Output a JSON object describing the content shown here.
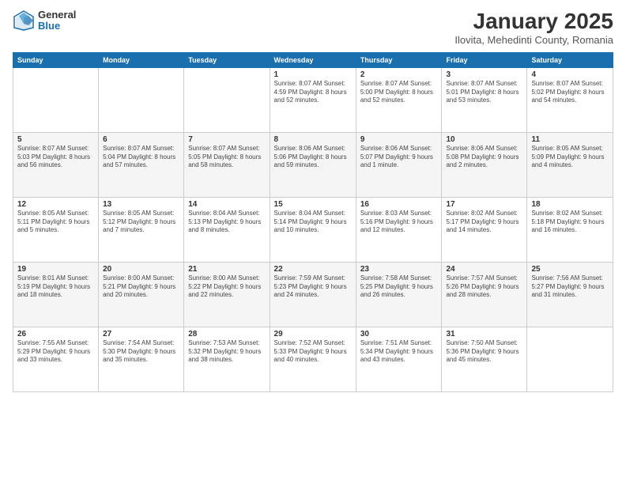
{
  "logo": {
    "general": "General",
    "blue": "Blue"
  },
  "title": "January 2025",
  "location": "Ilovita, Mehedinti County, Romania",
  "weekdays": [
    "Sunday",
    "Monday",
    "Tuesday",
    "Wednesday",
    "Thursday",
    "Friday",
    "Saturday"
  ],
  "weeks": [
    [
      {
        "day": "",
        "info": ""
      },
      {
        "day": "",
        "info": ""
      },
      {
        "day": "",
        "info": ""
      },
      {
        "day": "1",
        "info": "Sunrise: 8:07 AM\nSunset: 4:59 PM\nDaylight: 8 hours\nand 52 minutes."
      },
      {
        "day": "2",
        "info": "Sunrise: 8:07 AM\nSunset: 5:00 PM\nDaylight: 8 hours\nand 52 minutes."
      },
      {
        "day": "3",
        "info": "Sunrise: 8:07 AM\nSunset: 5:01 PM\nDaylight: 8 hours\nand 53 minutes."
      },
      {
        "day": "4",
        "info": "Sunrise: 8:07 AM\nSunset: 5:02 PM\nDaylight: 8 hours\nand 54 minutes."
      }
    ],
    [
      {
        "day": "5",
        "info": "Sunrise: 8:07 AM\nSunset: 5:03 PM\nDaylight: 8 hours\nand 56 minutes."
      },
      {
        "day": "6",
        "info": "Sunrise: 8:07 AM\nSunset: 5:04 PM\nDaylight: 8 hours\nand 57 minutes."
      },
      {
        "day": "7",
        "info": "Sunrise: 8:07 AM\nSunset: 5:05 PM\nDaylight: 8 hours\nand 58 minutes."
      },
      {
        "day": "8",
        "info": "Sunrise: 8:06 AM\nSunset: 5:06 PM\nDaylight: 8 hours\nand 59 minutes."
      },
      {
        "day": "9",
        "info": "Sunrise: 8:06 AM\nSunset: 5:07 PM\nDaylight: 9 hours\nand 1 minute."
      },
      {
        "day": "10",
        "info": "Sunrise: 8:06 AM\nSunset: 5:08 PM\nDaylight: 9 hours\nand 2 minutes."
      },
      {
        "day": "11",
        "info": "Sunrise: 8:05 AM\nSunset: 5:09 PM\nDaylight: 9 hours\nand 4 minutes."
      }
    ],
    [
      {
        "day": "12",
        "info": "Sunrise: 8:05 AM\nSunset: 5:11 PM\nDaylight: 9 hours\nand 5 minutes."
      },
      {
        "day": "13",
        "info": "Sunrise: 8:05 AM\nSunset: 5:12 PM\nDaylight: 9 hours\nand 7 minutes."
      },
      {
        "day": "14",
        "info": "Sunrise: 8:04 AM\nSunset: 5:13 PM\nDaylight: 9 hours\nand 8 minutes."
      },
      {
        "day": "15",
        "info": "Sunrise: 8:04 AM\nSunset: 5:14 PM\nDaylight: 9 hours\nand 10 minutes."
      },
      {
        "day": "16",
        "info": "Sunrise: 8:03 AM\nSunset: 5:16 PM\nDaylight: 9 hours\nand 12 minutes."
      },
      {
        "day": "17",
        "info": "Sunrise: 8:02 AM\nSunset: 5:17 PM\nDaylight: 9 hours\nand 14 minutes."
      },
      {
        "day": "18",
        "info": "Sunrise: 8:02 AM\nSunset: 5:18 PM\nDaylight: 9 hours\nand 16 minutes."
      }
    ],
    [
      {
        "day": "19",
        "info": "Sunrise: 8:01 AM\nSunset: 5:19 PM\nDaylight: 9 hours\nand 18 minutes."
      },
      {
        "day": "20",
        "info": "Sunrise: 8:00 AM\nSunset: 5:21 PM\nDaylight: 9 hours\nand 20 minutes."
      },
      {
        "day": "21",
        "info": "Sunrise: 8:00 AM\nSunset: 5:22 PM\nDaylight: 9 hours\nand 22 minutes."
      },
      {
        "day": "22",
        "info": "Sunrise: 7:59 AM\nSunset: 5:23 PM\nDaylight: 9 hours\nand 24 minutes."
      },
      {
        "day": "23",
        "info": "Sunrise: 7:58 AM\nSunset: 5:25 PM\nDaylight: 9 hours\nand 26 minutes."
      },
      {
        "day": "24",
        "info": "Sunrise: 7:57 AM\nSunset: 5:26 PM\nDaylight: 9 hours\nand 28 minutes."
      },
      {
        "day": "25",
        "info": "Sunrise: 7:56 AM\nSunset: 5:27 PM\nDaylight: 9 hours\nand 31 minutes."
      }
    ],
    [
      {
        "day": "26",
        "info": "Sunrise: 7:55 AM\nSunset: 5:29 PM\nDaylight: 9 hours\nand 33 minutes."
      },
      {
        "day": "27",
        "info": "Sunrise: 7:54 AM\nSunset: 5:30 PM\nDaylight: 9 hours\nand 35 minutes."
      },
      {
        "day": "28",
        "info": "Sunrise: 7:53 AM\nSunset: 5:32 PM\nDaylight: 9 hours\nand 38 minutes."
      },
      {
        "day": "29",
        "info": "Sunrise: 7:52 AM\nSunset: 5:33 PM\nDaylight: 9 hours\nand 40 minutes."
      },
      {
        "day": "30",
        "info": "Sunrise: 7:51 AM\nSunset: 5:34 PM\nDaylight: 9 hours\nand 43 minutes."
      },
      {
        "day": "31",
        "info": "Sunrise: 7:50 AM\nSunset: 5:36 PM\nDaylight: 9 hours\nand 45 minutes."
      },
      {
        "day": "",
        "info": ""
      }
    ]
  ]
}
